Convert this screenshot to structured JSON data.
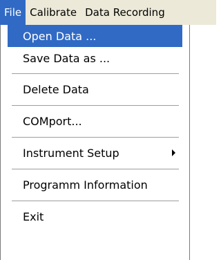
{
  "menubar": {
    "items": [
      "File",
      "Calibrate",
      "Data Recording"
    ]
  },
  "file_menu": {
    "items": [
      {
        "label": "Open Data ..."
      },
      {
        "label": "Save Data as ..."
      },
      {
        "label": "Delete Data"
      },
      {
        "label": "COMport..."
      },
      {
        "label": "Instrument Setup",
        "has_submenu": true
      },
      {
        "label": "Programm Information"
      },
      {
        "label": "Exit"
      }
    ]
  },
  "colors": {
    "highlight": "#316ac5",
    "menubar_bg": "#ece9d8"
  }
}
